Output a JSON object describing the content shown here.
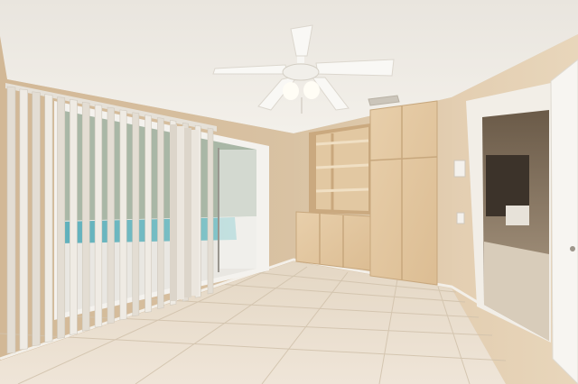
{
  "scene": {
    "kind": "interior-photo",
    "subject": "empty bedroom",
    "features": [
      "ceiling-fan",
      "vertical-blinds",
      "sliding-glass-door",
      "pool",
      "built-in-cabinets",
      "open-shelves",
      "tile-floor",
      "doorway-to-hallway"
    ]
  },
  "colors": {
    "ceiling": "#f0ece5",
    "wall": "#ddc6a6",
    "wood": "#e5c9a3",
    "floor": "#e8dccb",
    "blinds": "#ece8e1",
    "pool": "#6fb7bf",
    "door": "#f5f3ef"
  }
}
